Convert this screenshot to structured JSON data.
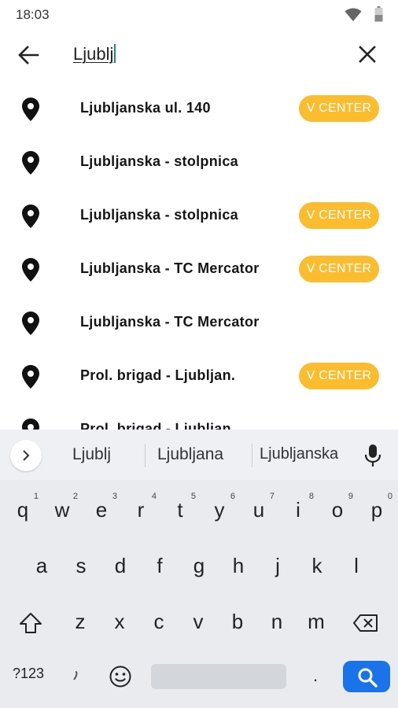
{
  "status_bar": {
    "time": "18:03"
  },
  "search": {
    "query": "Ljublj"
  },
  "results": [
    {
      "label": "Ljubljanska ul. 140",
      "badge": "V CENTER"
    },
    {
      "label": "Ljubljanska - stolpnica",
      "badge": ""
    },
    {
      "label": "Ljubljanska - stolpnica",
      "badge": "V CENTER"
    },
    {
      "label": "Ljubljanska - TC Mercator",
      "badge": "V CENTER"
    },
    {
      "label": "Ljubljanska - TC Mercator",
      "badge": ""
    },
    {
      "label": "Prol. brigad - Ljubljan.",
      "badge": "V CENTER"
    },
    {
      "label": "Prol. brigad - Ljubljan.",
      "badge": ""
    }
  ],
  "keyboard": {
    "suggestions": [
      "Ljublj",
      "Ljubljana",
      "Ljubljanska"
    ],
    "row1": [
      {
        "key": "q",
        "num": "1"
      },
      {
        "key": "w",
        "num": "2"
      },
      {
        "key": "e",
        "num": "3"
      },
      {
        "key": "r",
        "num": "4"
      },
      {
        "key": "t",
        "num": "5"
      },
      {
        "key": "y",
        "num": "6"
      },
      {
        "key": "u",
        "num": "7"
      },
      {
        "key": "i",
        "num": "8"
      },
      {
        "key": "o",
        "num": "9"
      },
      {
        "key": "p",
        "num": "0"
      }
    ],
    "row2": [
      "a",
      "s",
      "d",
      "f",
      "g",
      "h",
      "j",
      "k",
      "l"
    ],
    "row3": [
      "z",
      "x",
      "c",
      "v",
      "b",
      "n",
      "m"
    ],
    "symbols_label": "?123",
    "period": "."
  },
  "colors": {
    "badge": "#fbbd2e",
    "search_key": "#1a73e8",
    "caret": "#1a8f8a"
  }
}
